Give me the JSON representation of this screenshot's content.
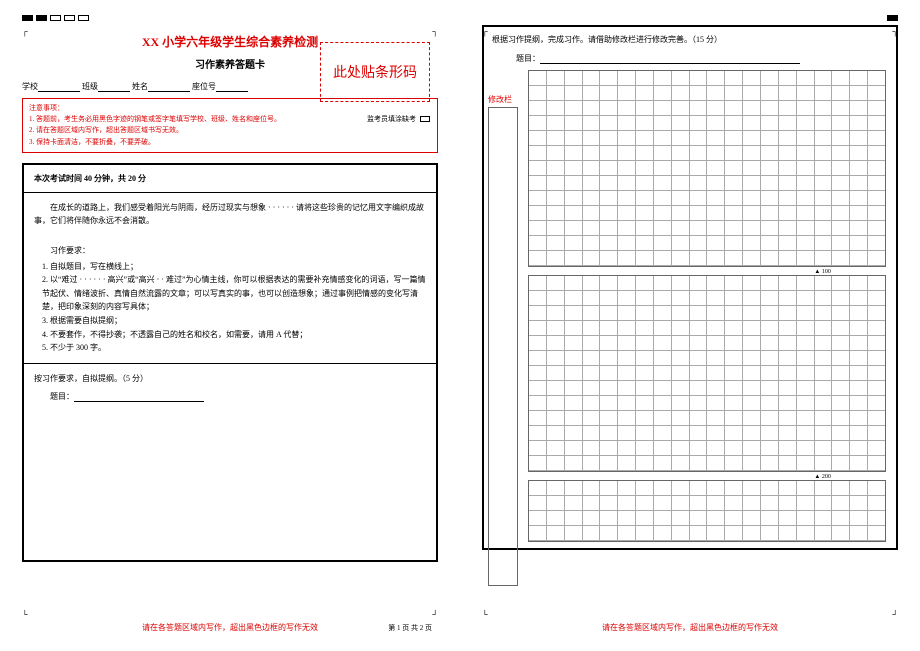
{
  "page1": {
    "title": "XX 小学六年级学生综合素养检测",
    "subtitle": "习作素养答题卡",
    "info": {
      "school": "学校",
      "class": "班级",
      "name": "姓名",
      "seat": "座位号"
    },
    "barcode": "此处贴条形码",
    "monitor": "监考员填涂缺考",
    "notice_title": "注意事项：",
    "notice1": "1. 答题前，考生务必用黑色字迹的钢笔或签字笔填写学校、班级、姓名和座位号。",
    "notice2": "2. 请在答题区域内写作，超出答题区域书写无效。",
    "notice3": "3. 保持卡面清洁，不要折叠，不要弄破。",
    "time": "本次考试时间 40 分钟，共 20 分",
    "prompt": "在成长的道路上，我们感受着阳光与阴雨，经历过现实与想象 · · · · · · 请将这些珍贵的记忆用文字编织成故事，它们将伴随你永远不会消散。",
    "req_title": "习作要求：",
    "req1": "1. 自拟题目，写在横线上；",
    "req2": "2. 以“难过 · · · · · · 高兴”或“高兴 · · 难过”为心情主线，你可以根据表达的需要补充情感变化的词语，写一篇情节起伏、情绪波折、真情自然流露的文章；可以写真实的事，也可以创造想象；通过事例把情感的变化写清楚，把印象深刻的内容写具体；",
    "req3": "3. 根据需要自拟提纲；",
    "req4": "4. 不要套作，不得抄袭；不透露自己的姓名和校名，如需要，请用 A 代替；",
    "req5": "5. 不少于 300 字。",
    "outline": "按习作要求，自拟提纲。（5 分）",
    "topic_label": "题目：",
    "footer": "请在各答题区域内写作，超出黑色边框的写作无效",
    "pager": "第 1 页 共 2 页"
  },
  "page2": {
    "head": "根据习作提纲，完成习作。请借助修改栏进行修改完善。（15 分）",
    "topic_label": "题目：",
    "corr": "修改栏",
    "wc100": "▲ 100",
    "wc200": "▲ 200",
    "footer": "请在各答题区域内写作，超出黑色边框的写作无效"
  }
}
